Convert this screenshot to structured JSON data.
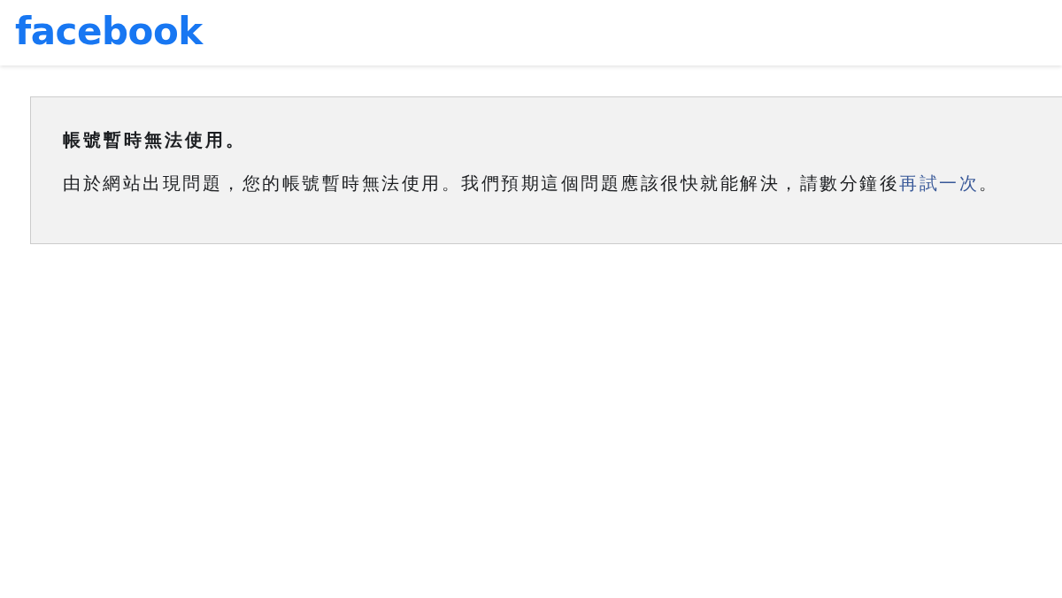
{
  "header": {
    "logo": "facebook"
  },
  "notice": {
    "title": "帳號暫時無法使用。",
    "message": {
      "text": "由於網站出現問題，您的帳號暫時無法使用。我們預期這個問題應該很快就能解決，請數分鐘後",
      "link": "再試一次",
      "end": "。"
    }
  }
}
